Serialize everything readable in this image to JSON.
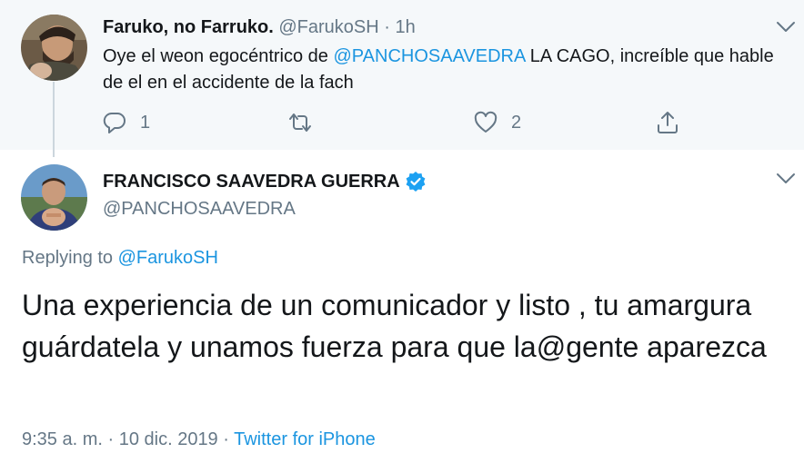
{
  "parent": {
    "name": "Faruko, no Farruko.",
    "handle": "@FarukoSH",
    "separator": "·",
    "time": "1h",
    "text_before": "Oye el weon egocéntrico de ",
    "mention": "@PANCHOSAAVEDRA",
    "text_after": " LA CAGO, increíble que hable de el en el accidente de la fach",
    "actions": {
      "reply_icon": "reply-icon",
      "reply_count": "1",
      "retweet_icon": "retweet-icon",
      "retweet_count": "",
      "like_icon": "heart-icon",
      "like_count": "2",
      "share_icon": "share-icon"
    }
  },
  "reply": {
    "name": "FRANCISCO SAAVEDRA GUERRA",
    "verified_icon": "verified-badge-icon",
    "handle": "@PANCHOSAAVEDRA",
    "replying_prefix": "Replying to ",
    "replying_to": "@FarukoSH",
    "text": "Una experiencia de un comunicador y listo , tu amargura guárdatela y unamos fuerza para que la@gente aparezca",
    "date": "9:35 a. m. · 10 dic. 2019",
    "separator": "·",
    "source": "Twitter for iPhone"
  },
  "colors": {
    "accent": "#1b95e0",
    "muted": "#657786",
    "text": "#14171a",
    "parent_background": "#f5f8fa"
  }
}
